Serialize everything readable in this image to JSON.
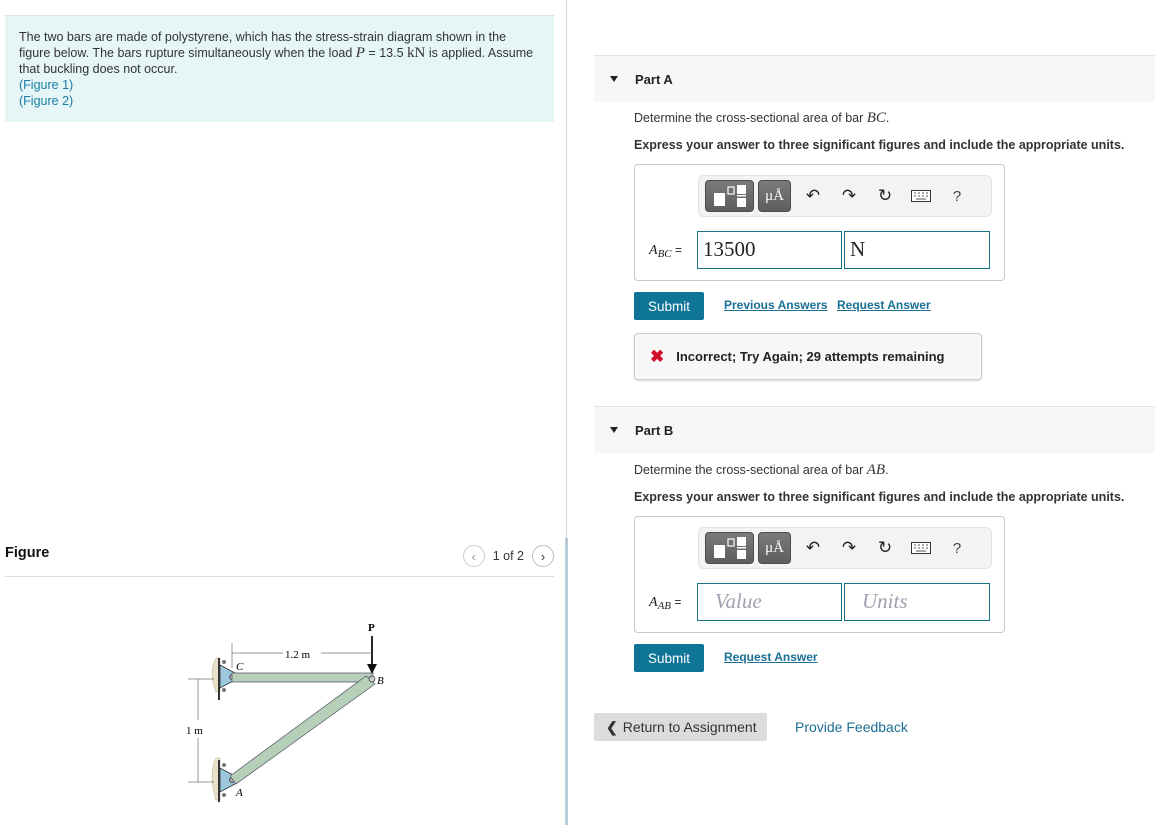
{
  "problem": {
    "text_1": "The two bars are made of polystyrene, which has the stress-strain diagram shown in the figure below. The bars rupture simultaneously when the load ",
    "load_symbol": "P",
    "load_eq": " = 13.5 ",
    "load_unit": "kN",
    "text_2": " is applied. Assume that buckling does not occur.",
    "figure_links": [
      "(Figure 1)",
      "(Figure 2)"
    ]
  },
  "figure": {
    "title": "Figure",
    "pager": {
      "current": 1,
      "total": 2,
      "text": "1 of 2",
      "prev_icon": "chevron-left-icon",
      "next_icon": "chevron-right-icon"
    },
    "diagram_labels": {
      "load": "P",
      "horizontal_dim": "1.2 m",
      "vertical_dim": "1 m",
      "point_a": "A",
      "point_b": "B",
      "point_c": "C"
    }
  },
  "parts": [
    {
      "title": "Part A",
      "prompt_text": "Determine the cross-sectional area of bar ",
      "prompt_math": "BC",
      "instruction": "Express your answer to three significant figures and include the appropriate units.",
      "label_var": "A",
      "label_sub": "BC",
      "label_eq": " =",
      "value": "13500",
      "units": "N",
      "value_placeholder": "Value",
      "units_placeholder": "Units",
      "submit_label": "Submit",
      "links": [
        "Previous Answers",
        "Request Answer"
      ],
      "feedback": {
        "icon": "x-icon",
        "text": "Incorrect; Try Again; 29 attempts remaining",
        "color": "#d0102a"
      }
    },
    {
      "title": "Part B",
      "prompt_text": "Determine the cross-sectional area of bar ",
      "prompt_math": "AB",
      "instruction": "Express your answer to three significant figures and include the appropriate units.",
      "label_var": "A",
      "label_sub": "AB",
      "label_eq": " =",
      "value": "",
      "units": "",
      "value_placeholder": "Value",
      "units_placeholder": "Units",
      "submit_label": "Submit",
      "links": [
        "Request Answer"
      ]
    }
  ],
  "toolbar": {
    "units_label": "μÅ",
    "help_label": "?",
    "icons": [
      "templates-icon",
      "units-icon",
      "undo-icon",
      "redo-icon",
      "reset-icon",
      "keyboard-icon",
      "help-icon"
    ]
  },
  "footer": {
    "return_label": "Return to Assignment",
    "feedback_label": "Provide Feedback"
  },
  "colors": {
    "accent": "#0f7597",
    "link": "#1a6f95",
    "field_border": "#1a7188",
    "intro_bg": "#e6f5f6"
  }
}
